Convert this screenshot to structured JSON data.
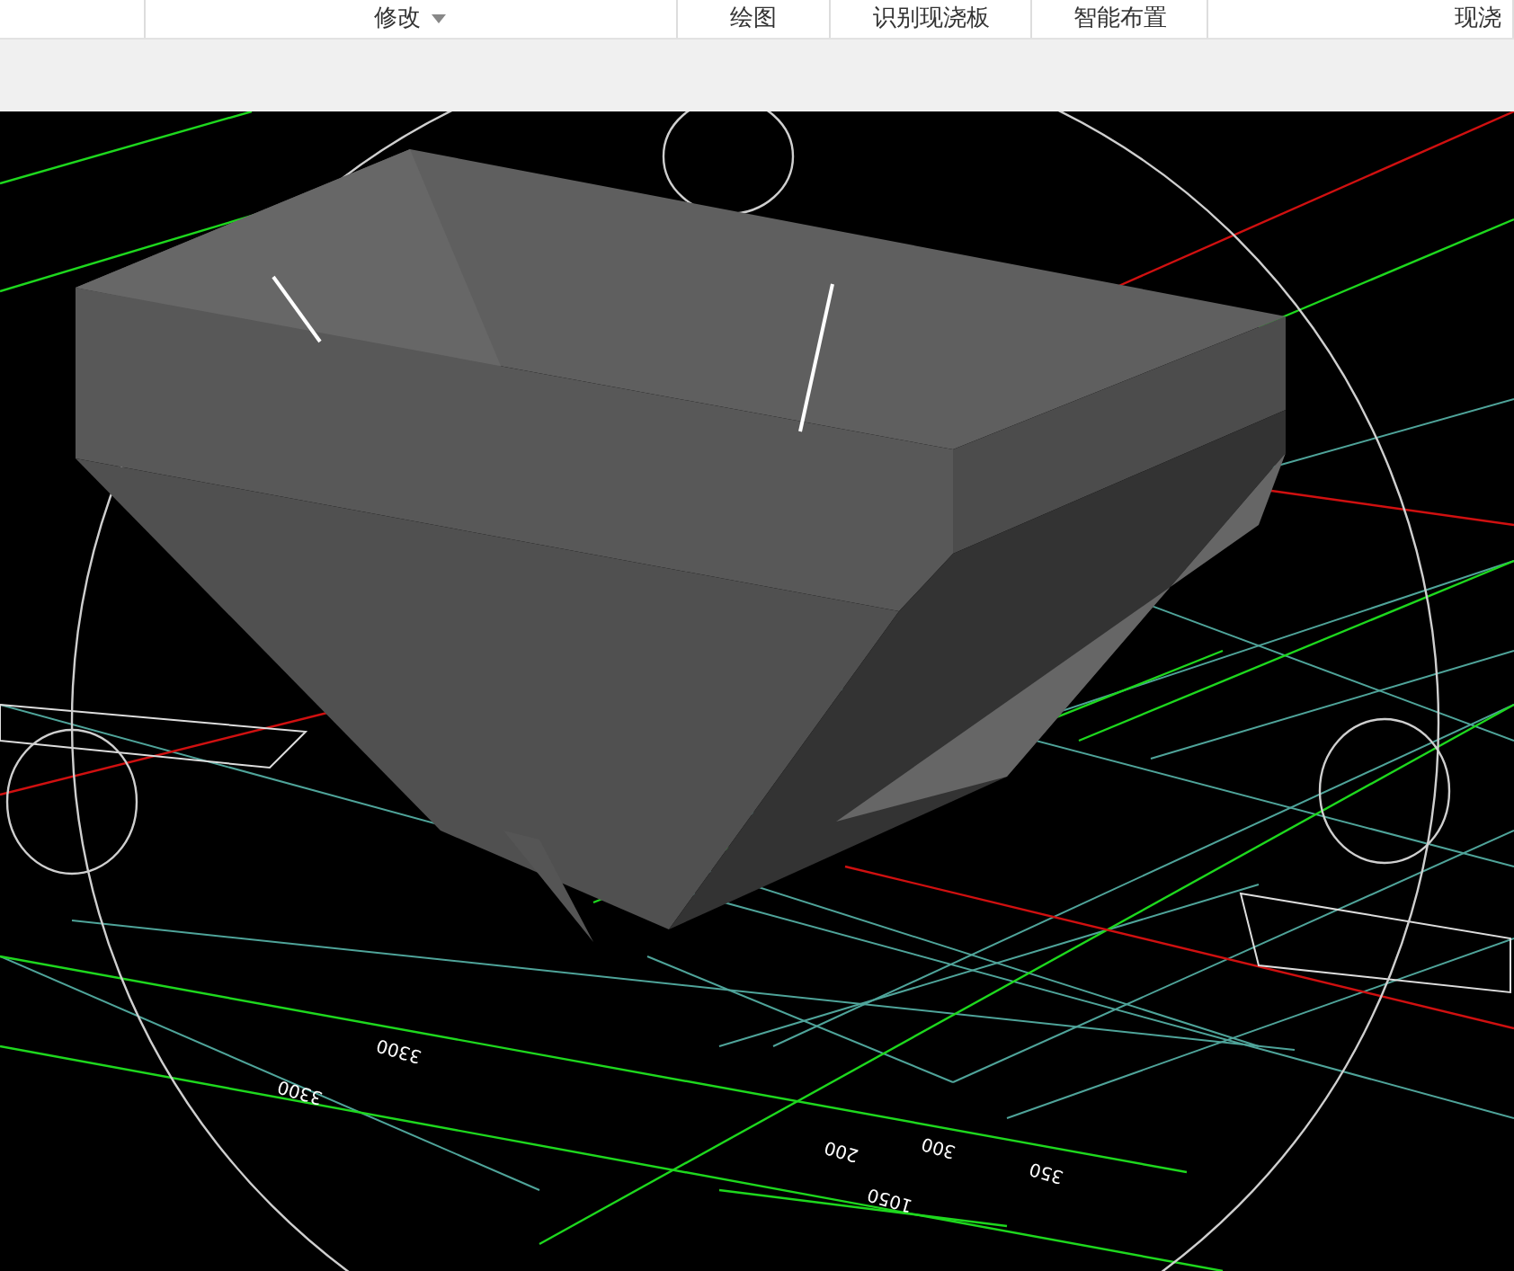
{
  "ribbon": {
    "groups": [
      {
        "label": "修改",
        "dropdown": true
      },
      {
        "label": "绘图",
        "dropdown": false
      },
      {
        "label": "识别现浇板",
        "dropdown": false
      },
      {
        "label": "智能布置",
        "dropdown": false
      },
      {
        "label": "现浇",
        "dropdown": false
      }
    ]
  },
  "viewport": {
    "dimension_labels": [
      "3300",
      "3300",
      "200",
      "300",
      "350",
      "1050"
    ]
  }
}
